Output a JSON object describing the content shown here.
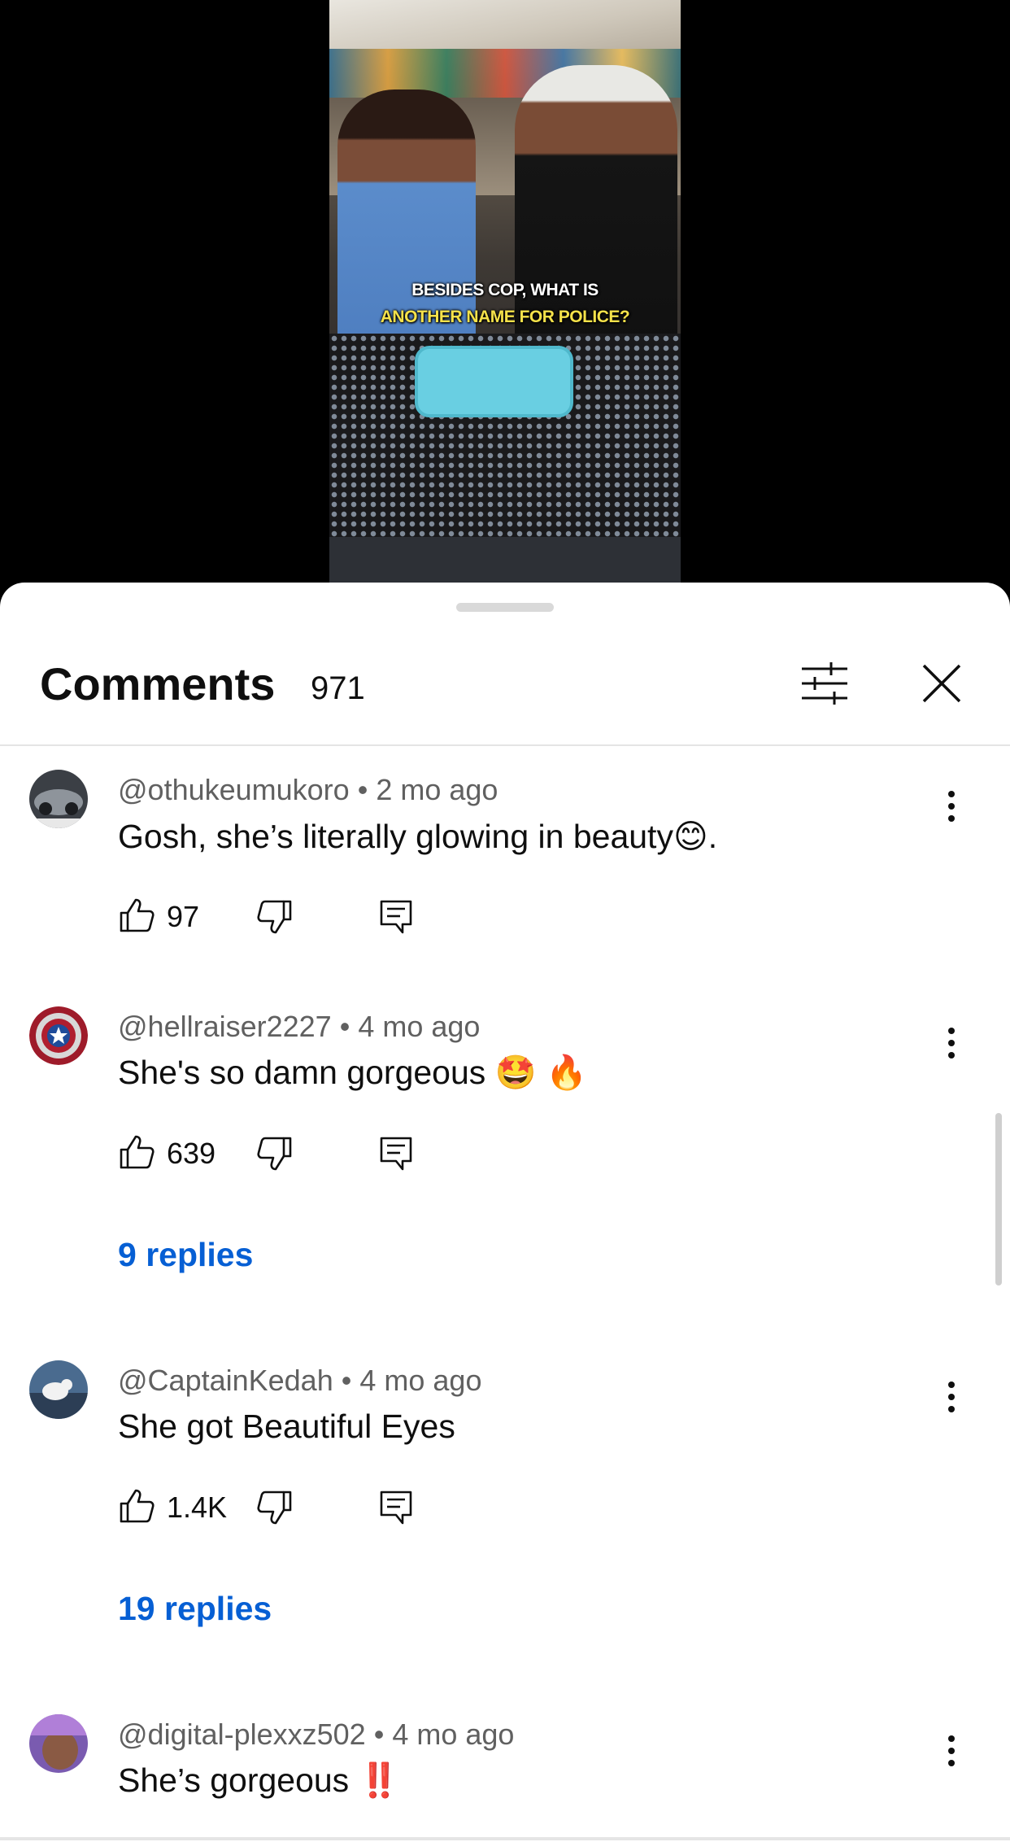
{
  "video": {
    "caption_line1": "BESIDES COP, WHAT IS",
    "caption_line2": "ANOTHER NAME FOR POLICE?"
  },
  "sheet": {
    "title": "Comments",
    "count": "971",
    "filter_icon": "filter-sliders-icon",
    "close_icon": "close-icon"
  },
  "comments": [
    {
      "author": "@othukeumukoro",
      "age": "2 mo ago",
      "text": "Gosh, she’s literally glowing in beauty😊.",
      "likes": "97",
      "replies": "",
      "avatar_color": "#3b3f45"
    },
    {
      "author": "@hellraiser2227",
      "age": "4 mo ago",
      "text": "She's so damn gorgeous 🤩 🔥",
      "likes": "639",
      "replies": "9 replies",
      "avatar_color": "#9e1b2a"
    },
    {
      "author": "@CaptainKedah",
      "age": "4 mo ago",
      "text": "She got Beautiful Eyes",
      "likes": "1.4K",
      "replies": "19 replies",
      "avatar_color": "#4a6b8f"
    },
    {
      "author": "@digital-plexxz502",
      "age": "4 mo ago",
      "text": "She’s gorgeous ‼️",
      "likes": "",
      "replies": "",
      "avatar_color": "#7a5bb0"
    }
  ],
  "meta_separator": "•",
  "colors": {
    "link_blue": "#065fd4",
    "meta_gray": "#606060",
    "text_dark": "#0f0f0f"
  }
}
